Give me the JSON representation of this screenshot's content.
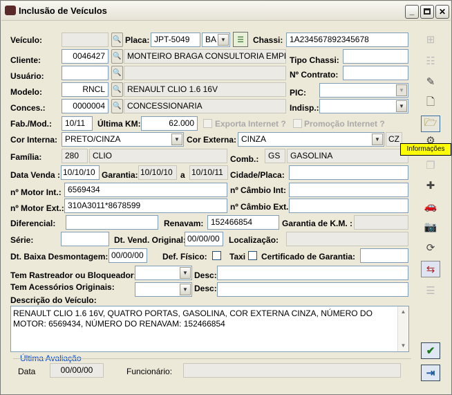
{
  "window": {
    "title": "Inclusão de Veículos"
  },
  "labels": {
    "veiculo": "Veículo:",
    "placa": "Placa:",
    "chassi": "Chassi:",
    "cliente": "Cliente:",
    "tipo_chassi": "Tipo Chassi:",
    "usuario": "Usuário:",
    "contrato": "Nº Contrato:",
    "modelo": "Modelo:",
    "pic": "PIC:",
    "conces": "Conces.:",
    "indisp": "Indisp.:",
    "fab_mod": "Fab./Mod.:",
    "ultima_km": "Última KM:",
    "exporta": "Exporta Internet ?",
    "promocao": "Promoção Internet ?",
    "cor_interna": "Cor Interna:",
    "cor_externa": "Cor Externa:",
    "familia": "Família:",
    "comb": "Comb.:",
    "data_venda": "Data Venda :",
    "garantia": "Garantia:",
    "a": "a",
    "cidade_placa": "Cidade/Placa:",
    "motor_int": "nº Motor Int.:",
    "cambio_int": "nº Câmbio Int:",
    "motor_ext": "nº Motor Ext.:",
    "cambio_ext": "nº Câmbio Ext.:",
    "diferencial": "Diferencial:",
    "renavam": "Renavam:",
    "garantia_km": "Garantia de K.M. :",
    "serie": "Série:",
    "dt_vend_original": "Dt. Vend. Original:",
    "localizacao": "Localização:",
    "dt_baixa": "Dt. Baixa Desmontagem:",
    "def_fisico": "Def. Físico:",
    "taxi": "Taxi",
    "certificado": "Certificado de Garantia:",
    "rastreador": "Tem Rastreador ou Bloqueador:",
    "desc": "Desc:",
    "acessorios": "Tem Acessórios Originais:",
    "descricao": "Descrição do Veículo:",
    "ultima_avaliacao": "Última Avaliação",
    "data": "Data",
    "funcionario": "Funcionário:"
  },
  "values": {
    "placa": "JPT-5049",
    "uf": "BA",
    "chassi": "1A234567892345678",
    "cliente_cod": "0046427",
    "cliente_nome": "MONTEIRO BRAGA CONSULTORIA EMPR",
    "modelo_cod": "RNCL",
    "modelo_nome": "RENAULT CLIO 1.6 16V",
    "conces_cod": "0000004",
    "conces_nome": "CONCESSIONARIA",
    "fab_mod": "10/11",
    "ultima_km": "62.000",
    "cor_interna": "PRETO/CINZA",
    "cor_externa": "CINZA",
    "cor_externa_cod": "CZ",
    "familia_cod": "280",
    "familia_nome": "CLIO",
    "comb_cod": "GS",
    "comb_nome": "GASOLINA",
    "data_venda": "10/10/10",
    "garantia_ini": "10/10/10",
    "garantia_fim": "10/10/11",
    "motor_int": "6569434",
    "motor_ext": "310A3011*8678599",
    "renavam": "152466854",
    "dt_vend_original": "00/00/00",
    "dt_baixa": "00/00/00",
    "avaliacao_data": "00/00/00",
    "descricao": "RENAULT CLIO 1.6 16V, QUATRO PORTAS, GASOLINA, COR EXTERNA CINZA, NÚMERO DO MOTOR: 6569434, NÚMERO DO RENAVAM: 152466854"
  },
  "tooltip": "Informações",
  "colors": {
    "link_blue": "#0046d5",
    "tooltip_bg": "#ffff00"
  },
  "toolbar_icons": [
    "add-record-icon",
    "list-icon",
    "pencil-icon",
    "document-icon",
    "folder-open-icon",
    "tools-icon",
    "copy-icon",
    "plus-icon",
    "car-icon",
    "camera-icon",
    "refresh-icon",
    "transfer-icon",
    "list-edit-icon"
  ],
  "bottom_buttons": [
    "save-confirm-icon",
    "exit-icon"
  ]
}
